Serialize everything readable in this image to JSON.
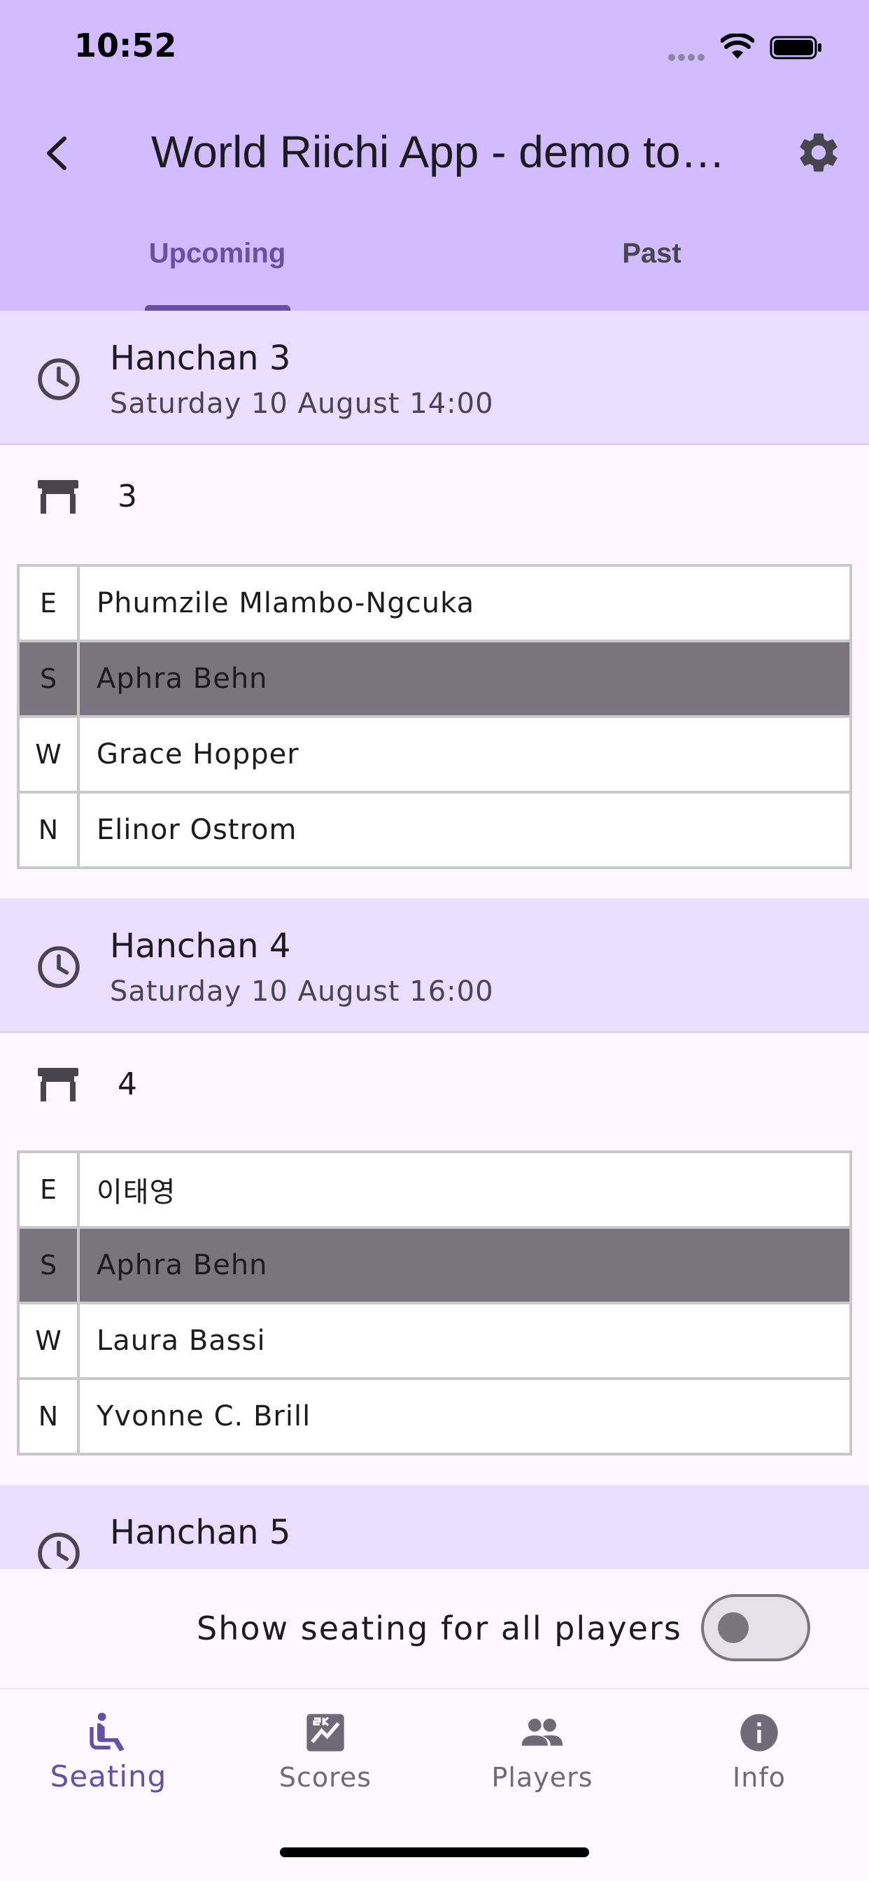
{
  "status_bar": {
    "time": "10:52"
  },
  "app_bar": {
    "title": "World Riichi App - demo tournament",
    "back_icon": "chevron-left-icon",
    "settings_icon": "gear-icon"
  },
  "tabs": [
    {
      "label": "Upcoming",
      "selected": true
    },
    {
      "label": "Past",
      "selected": false
    }
  ],
  "rounds": [
    {
      "name": "Hanchan 3",
      "time": "Saturday 10 August 14:00",
      "table": "3",
      "seats": [
        {
          "wind": "E",
          "player": "Phumzile Mlambo-Ngcuka",
          "highlight": false
        },
        {
          "wind": "S",
          "player": "Aphra Behn",
          "highlight": true
        },
        {
          "wind": "W",
          "player": "Grace Hopper",
          "highlight": false
        },
        {
          "wind": "N",
          "player": "Elinor Ostrom",
          "highlight": false
        }
      ]
    },
    {
      "name": "Hanchan 4",
      "time": "Saturday 10 August 16:00",
      "table": "4",
      "seats": [
        {
          "wind": "E",
          "player": "이태영",
          "highlight": false
        },
        {
          "wind": "S",
          "player": "Aphra Behn",
          "highlight": true
        },
        {
          "wind": "W",
          "player": "Laura Bassi",
          "highlight": false
        },
        {
          "wind": "N",
          "player": "Yvonne C. Brill",
          "highlight": false
        }
      ]
    },
    {
      "name": "Hanchan 5"
    }
  ],
  "toggle": {
    "label": "Show seating for all players",
    "on": false
  },
  "nav": [
    {
      "label": "Seating",
      "icon": "seat-icon",
      "active": true
    },
    {
      "label": "Scores",
      "icon": "scoreboard-icon",
      "active": false
    },
    {
      "label": "Players",
      "icon": "people-icon",
      "active": false
    },
    {
      "label": "Info",
      "icon": "info-icon",
      "active": false
    }
  ],
  "colors": {
    "accent": "#6750A4",
    "header": "#D0BCFF",
    "round_header": "#EADDFF",
    "highlight_row": "#79747E"
  }
}
